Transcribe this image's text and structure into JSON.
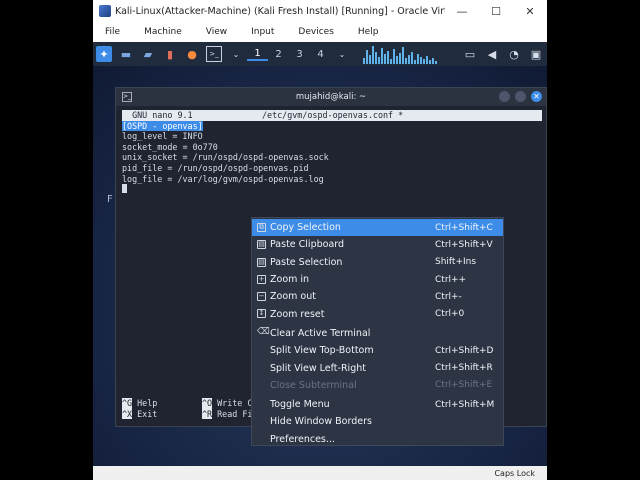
{
  "vbox": {
    "title": "Kali-Linux(Attacker-Machine) (Kali Fresh Install) [Running] - Oracle VirtualBox",
    "controls": {
      "minimize": "—",
      "maximize": "☐",
      "close": "✕"
    },
    "menu": [
      "File",
      "Machine",
      "View",
      "Input",
      "Devices",
      "Help"
    ]
  },
  "panel": {
    "workspaces": [
      "1",
      "2",
      "3",
      "4"
    ],
    "active_workspace": "1",
    "accent": "#3d8de8"
  },
  "desktop": {
    "letter": "F"
  },
  "terminal": {
    "title": "mujahid@kali: ~",
    "icon": ">_",
    "nano_version": "  GNU nano 9.1",
    "file_path": "/etc/gvm/ospd-openvas.conf *",
    "section": "[OSPD - openvas]",
    "lines": [
      "log_level = INFO",
      "socket_mode = 0o770",
      "unix_socket = /run/ospd/ospd-openvas.sock",
      "pid_file = /run/ospd/ospd-openvas.pid",
      "log_file = /var/log/gvm/ospd-openvas.log"
    ],
    "help": {
      "row1": [
        {
          "key": "^G",
          "text": " Help"
        },
        {
          "key": "^O",
          "text": " Write C"
        }
      ],
      "row2": [
        {
          "key": "^X",
          "text": " Exit"
        },
        {
          "key": "^R",
          "text": " Read Fi"
        }
      ]
    }
  },
  "context_menu": {
    "items": [
      {
        "label": "Copy Selection",
        "shortcut": "Ctrl+Shift+C",
        "icon": "⧉"
      },
      {
        "label": "Paste Clipboard",
        "shortcut": "Ctrl+Shift+V",
        "icon": "▤"
      },
      {
        "label": "Paste Selection",
        "shortcut": "Shift+Ins",
        "icon": "▤"
      },
      {
        "label": "Zoom in",
        "shortcut": "Ctrl++",
        "icon": "+"
      },
      {
        "label": "Zoom out",
        "shortcut": "Ctrl+-",
        "icon": "−"
      },
      {
        "label": "Zoom reset",
        "shortcut": "Ctrl+0",
        "icon": "↕"
      },
      {
        "label": "Clear Active Terminal",
        "shortcut": "",
        "icon": "⌫"
      },
      {
        "label": "Split View Top-Bottom",
        "shortcut": "Ctrl+Shift+D"
      },
      {
        "label": "Split View Left-Right",
        "shortcut": "Ctrl+Shift+R"
      },
      {
        "label": "Close Subterminal",
        "shortcut": "Ctrl+Shift+E"
      },
      {
        "label": "Toggle Menu",
        "shortcut": "Ctrl+Shift+M"
      },
      {
        "label": "Hide Window Borders",
        "shortcut": ""
      },
      {
        "label": "Preferences...",
        "shortcut": ""
      }
    ]
  },
  "status": {
    "caps_lock": "Caps Lock"
  }
}
